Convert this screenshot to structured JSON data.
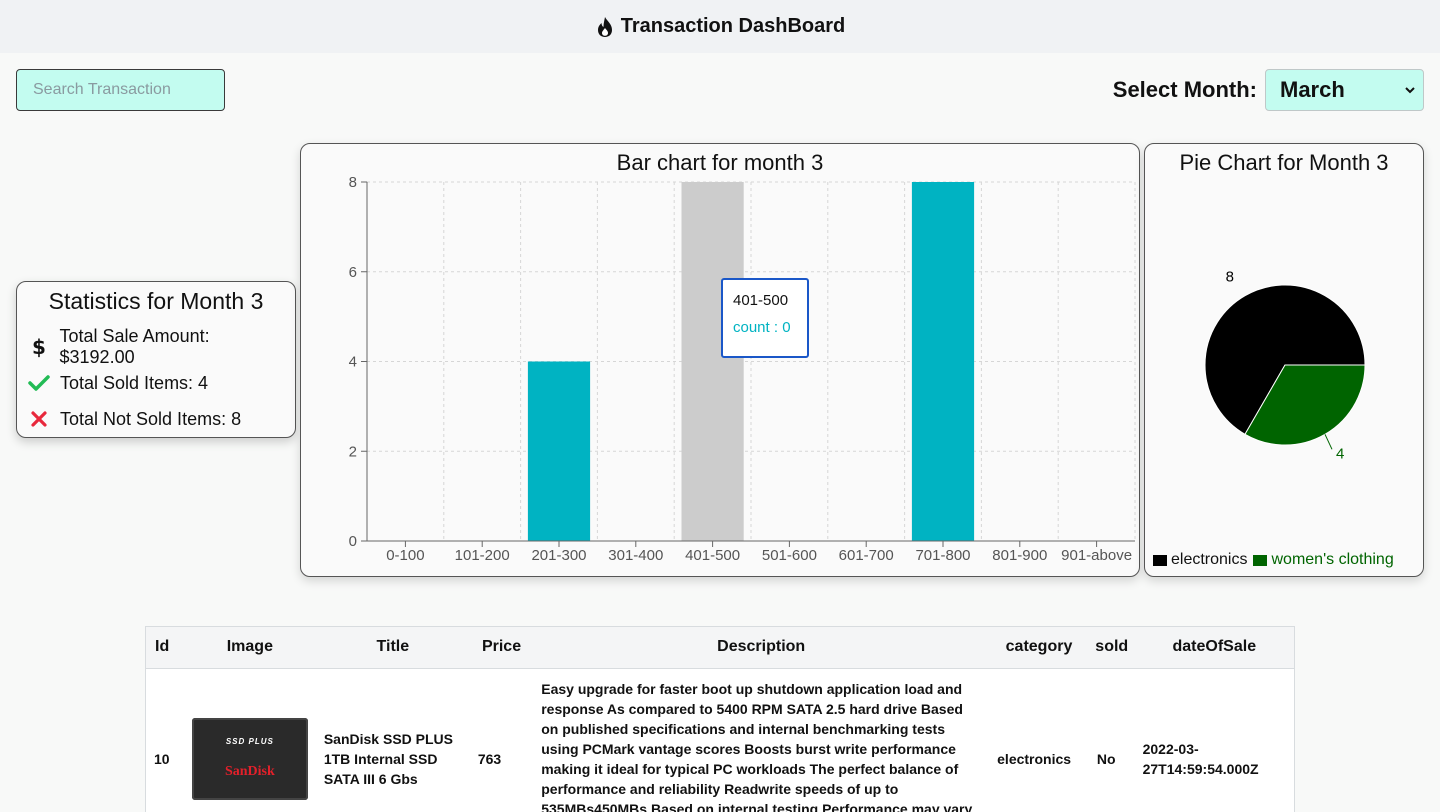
{
  "header": {
    "title": "Transaction DashBoard",
    "icon": "flame-icon"
  },
  "search": {
    "placeholder": "Search Transaction",
    "value": ""
  },
  "month_selector": {
    "label": "Select Month:",
    "selected": "March"
  },
  "statistics": {
    "title": "Statistics for Month 3",
    "items": [
      {
        "icon": "dollar-icon",
        "text": "Total Sale Amount: $3192.00"
      },
      {
        "icon": "check-icon",
        "text": "Total Sold Items: 4",
        "color": "#22bb55"
      },
      {
        "icon": "cross-icon",
        "text": "Total Not Sold Items: 8",
        "color": "#e8283c"
      }
    ]
  },
  "bar_chart_card": {
    "title": "Bar chart for month 3",
    "tooltip": {
      "label": "401-500",
      "value_text": "count : 0"
    }
  },
  "pie_chart_card": {
    "title": "Pie Chart for Month 3"
  },
  "chart_data": [
    {
      "type": "bar",
      "title": "Bar chart for month 3",
      "categories": [
        "0-100",
        "101-200",
        "201-300",
        "301-400",
        "401-500",
        "501-600",
        "601-700",
        "701-800",
        "801-900",
        "901-above"
      ],
      "values": [
        0,
        0,
        4,
        0,
        0,
        0,
        0,
        8,
        0,
        0
      ],
      "ylim": [
        0,
        8
      ],
      "yticks": [
        0,
        2,
        4,
        6,
        8
      ],
      "grid": true,
      "bar_color": "#00b3c2",
      "highlight_category": "401-500",
      "highlight_color": "#cccccc"
    },
    {
      "type": "pie",
      "title": "Pie Chart for Month 3",
      "series": [
        {
          "name": "electronics",
          "value": 8,
          "color": "#000000"
        },
        {
          "name": "women's clothing",
          "value": 4,
          "color": "#006400"
        }
      ],
      "legend": "bottom"
    }
  ],
  "table": {
    "columns": [
      "Id",
      "Image",
      "Title",
      "Price",
      "Description",
      "category",
      "sold",
      "dateOfSale"
    ],
    "rows": [
      {
        "id": "10",
        "image": {
          "top_text": "SSD PLUS",
          "brand": "SanDisk"
        },
        "title": "SanDisk SSD PLUS 1TB Internal SSD SATA III 6 Gbs",
        "price": "763",
        "description": "Easy upgrade for faster boot up shutdown application load and response As compared to 5400 RPM SATA 2.5 hard drive Based on published specifications and internal benchmarking tests using PCMark vantage scores Boosts burst write performance making it ideal for typical PC workloads The perfect balance of performance and reliability Readwrite speeds of up to 535MBs450MBs Based on internal testing Performance may vary depending upon drive",
        "category": "electronics",
        "sold": "No",
        "dateOfSale": "2022-03-27T14:59:54.000Z"
      }
    ]
  }
}
